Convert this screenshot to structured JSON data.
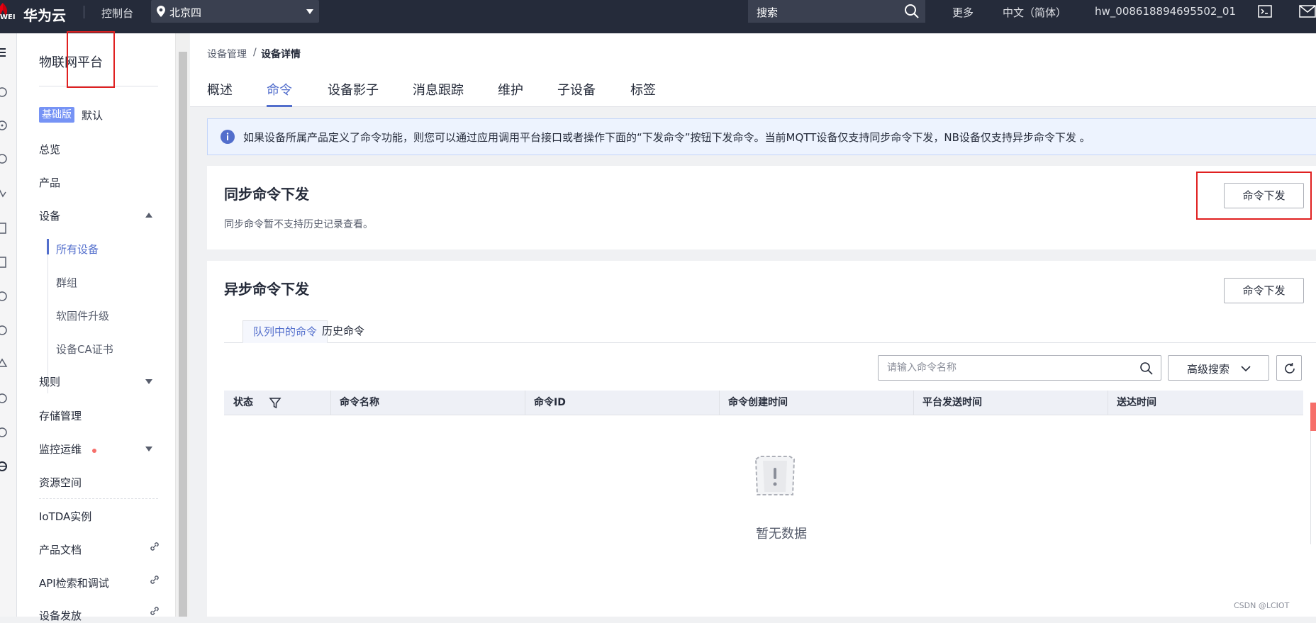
{
  "topbar": {
    "logo_sub": "WEI",
    "brand": "华为云",
    "console": "控制台",
    "region": "北京四",
    "search_placeholder": "搜索",
    "more": "更多",
    "language": "中文（简体）",
    "user": "hw_008618894695502_01"
  },
  "sidebar": {
    "title": "物联网平台",
    "edition_badge": "基础版",
    "edition_default": "默认",
    "items": [
      {
        "label": "总览"
      },
      {
        "label": "产品"
      },
      {
        "label": "设备"
      },
      {
        "label": "所有设备"
      },
      {
        "label": "群组"
      },
      {
        "label": "软固件升级"
      },
      {
        "label": "设备CA证书"
      },
      {
        "label": "规则"
      },
      {
        "label": "存储管理"
      },
      {
        "label": "监控运维"
      },
      {
        "label": "资源空间"
      },
      {
        "label": "IoTDA实例"
      },
      {
        "label": "产品文档"
      },
      {
        "label": "API检索和调试"
      },
      {
        "label": "设备发放"
      }
    ]
  },
  "breadcrumb": {
    "parent": "设备管理",
    "separator": "/",
    "current": "设备详情"
  },
  "tabs": [
    {
      "label": "概述"
    },
    {
      "label": "命令"
    },
    {
      "label": "设备影子"
    },
    {
      "label": "消息跟踪"
    },
    {
      "label": "维护"
    },
    {
      "label": "子设备"
    },
    {
      "label": "标签"
    }
  ],
  "notice": "如果设备所属产品定义了命令功能，则您可以通过应用调用平台接口或者操作下面的“下发命令”按钮下发命令。当前MQTT设备仅支持同步命令下发，NB设备仅支持异步命令下发 。",
  "sync_section": {
    "title": "同步命令下发",
    "subtitle": "同步命令暂不支持历史记录查看。",
    "button": "命令下发"
  },
  "async_section": {
    "title": "异步命令下发",
    "button": "命令下发",
    "subtabs": [
      {
        "label": "队列中的命令"
      },
      {
        "label": "历史命令"
      }
    ],
    "search_placeholder": "请输入命令名称",
    "advanced_search": "高级搜索",
    "columns": [
      {
        "label": "状态"
      },
      {
        "label": "命令名称"
      },
      {
        "label": "命令ID"
      },
      {
        "label": "命令创建时间"
      },
      {
        "label": "平台发送时间"
      },
      {
        "label": "送达时间"
      }
    ],
    "empty_text": "暂无数据"
  },
  "watermark": "CSDN @LCIOT",
  "colors": {
    "topbar": "#252b3a",
    "accent": "#526ecc",
    "highlight": "#e02020",
    "notice_bg": "#edf3fe",
    "badge": "#7693f5"
  }
}
